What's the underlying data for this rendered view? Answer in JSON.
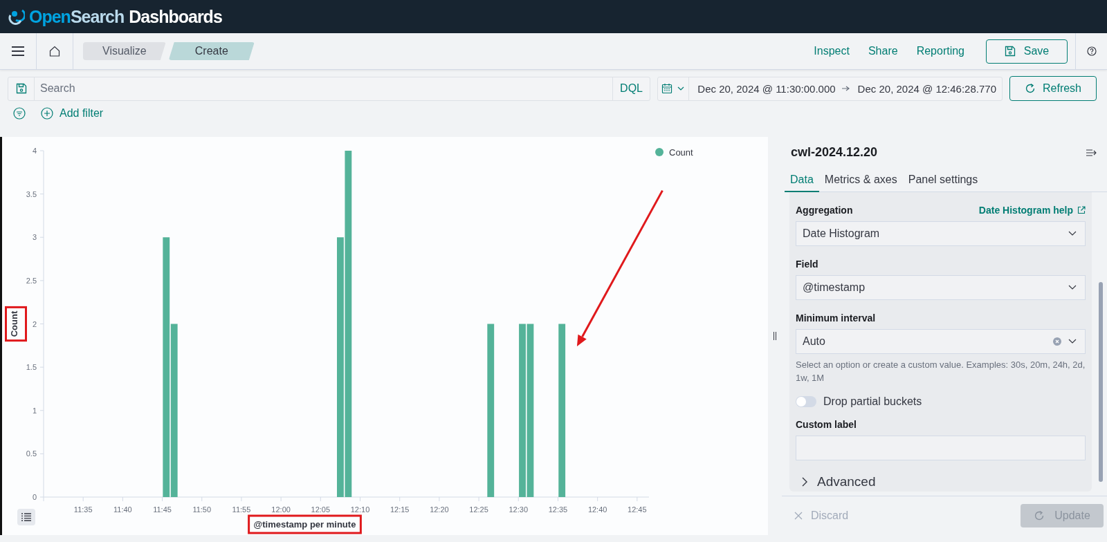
{
  "header": {
    "brand_parts": [
      "Open",
      "Search",
      "Dashboards"
    ]
  },
  "nav": {
    "breadcrumbs": [
      {
        "label": "Visualize",
        "selected": false
      },
      {
        "label": "Create",
        "selected": true
      }
    ],
    "links": [
      "Inspect",
      "Share",
      "Reporting"
    ],
    "save": "Save"
  },
  "query": {
    "placeholder": "Search",
    "language": "DQL",
    "start": "Dec 20, 2024 @ 11:30:00.000",
    "end": "Dec 20, 2024 @ 12:46:28.770",
    "refresh": "Refresh"
  },
  "filters": {
    "add": "Add filter"
  },
  "chart": {
    "chart_data": {
      "type": "bar",
      "xlabel": "@timestamp per minute",
      "ylabel": "Count",
      "x": [
        705.5,
        706.5,
        727.5,
        728.5,
        746.5,
        750.5,
        751.5,
        755.5
      ],
      "series": [
        {
          "name": "Count",
          "color": "#54b399",
          "values": [
            3,
            2,
            3,
            4,
            2,
            2,
            2,
            2
          ]
        }
      ],
      "xlim": [
        690,
        766.5
      ],
      "ylim": [
        0,
        4
      ],
      "xticks": [
        {
          "value": 695,
          "label": "11:35"
        },
        {
          "value": 700,
          "label": "11:40"
        },
        {
          "value": 705,
          "label": "11:45"
        },
        {
          "value": 710,
          "label": "11:50"
        },
        {
          "value": 715,
          "label": "11:55"
        },
        {
          "value": 720,
          "label": "12:00"
        },
        {
          "value": 725,
          "label": "12:05"
        },
        {
          "value": 730,
          "label": "12:10"
        },
        {
          "value": 735,
          "label": "12:15"
        },
        {
          "value": 740,
          "label": "12:20"
        },
        {
          "value": 745,
          "label": "12:25"
        },
        {
          "value": 750,
          "label": "12:30"
        },
        {
          "value": 755,
          "label": "12:35"
        },
        {
          "value": 760,
          "label": "12:40"
        },
        {
          "value": 765,
          "label": "12:45"
        }
      ],
      "yticks": [
        0,
        0.5,
        1,
        1.5,
        2,
        2.5,
        3,
        3.5,
        4
      ]
    },
    "overlay": {
      "y_title_framed": true,
      "x_title_framed": true,
      "arrow_shown": true
    }
  },
  "editor": {
    "index": "cwl-2024.12.20",
    "tabs": [
      {
        "label": "Data",
        "selected": true
      },
      {
        "label": "Metrics & axes",
        "selected": false
      },
      {
        "label": "Panel settings",
        "selected": false
      }
    ],
    "fields": [
      {
        "kind": "select",
        "label": "Aggregation",
        "link": "Date Histogram help",
        "value": "Date Histogram"
      },
      {
        "kind": "select",
        "label": "Field",
        "value": "@timestamp"
      },
      {
        "kind": "combo",
        "label": "Minimum interval",
        "value": "Auto",
        "help": "Select an option or create a custom value. Examples: 30s, 20m, 24h, 2d, 1w, 1M"
      },
      {
        "kind": "switch",
        "label": "Drop partial buckets",
        "on": false
      },
      {
        "kind": "text",
        "label": "Custom label"
      }
    ],
    "advanced": {
      "label": "Advanced",
      "expanded": false
    },
    "discard": "Discard",
    "update": {
      "label": "Update",
      "disabled": true
    }
  }
}
